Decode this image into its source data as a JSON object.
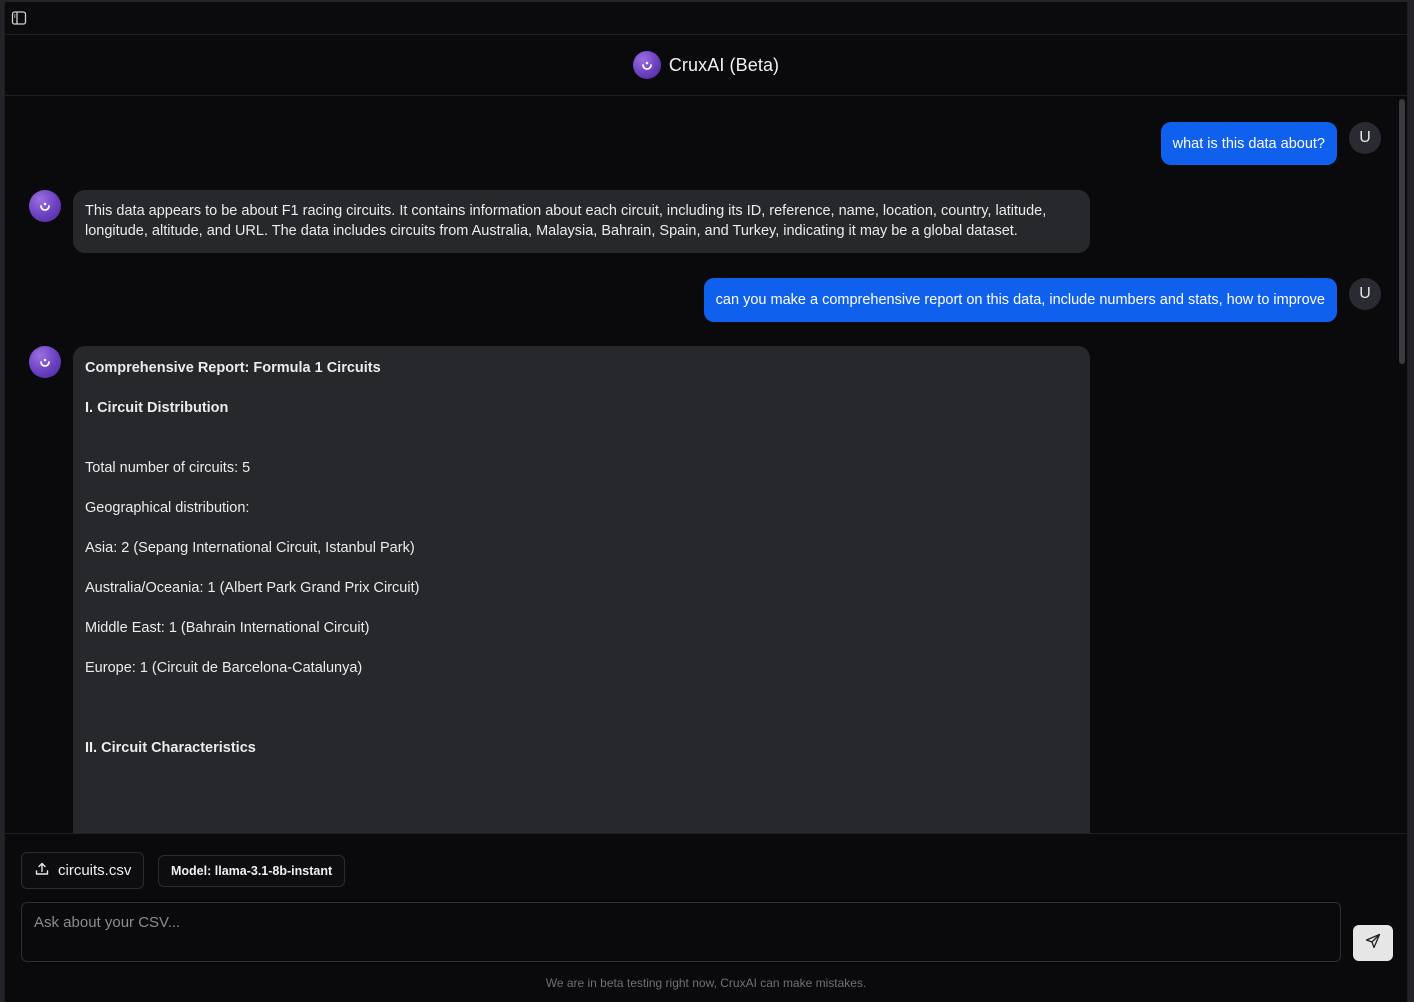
{
  "app": {
    "title": "CruxAI (Beta)"
  },
  "messages": [
    {
      "role": "user",
      "avatar": "U",
      "text": "what is this data about?"
    },
    {
      "role": "assistant",
      "text_line1": "This data appears to be about F1 racing circuits. It contains information about each circuit, including its ID, reference, name, location, country, latitude,",
      "text_line2": "longitude, altitude, and URL. The data includes circuits from Australia, Malaysia, Bahrain, Spain, and Turkey, indicating it may be a global dataset."
    },
    {
      "role": "user",
      "avatar": "U",
      "text": "can you make a comprehensive report on this data, include numbers and stats, how to improve"
    },
    {
      "role": "assistant",
      "report": {
        "title": "Comprehensive Report: Formula 1 Circuits",
        "section1": "I. Circuit Distribution",
        "total": "Total number of circuits: 5",
        "geo": "Geographical distribution:",
        "asia": "Asia: 2 (Sepang International Circuit, Istanbul Park)",
        "oceania": "Australia/Oceania: 1 (Albert Park Grand Prix Circuit)",
        "middle_east": "Middle East: 1 (Bahrain International Circuit)",
        "europe": "Europe: 1 (Circuit de Barcelona-Catalunya)",
        "section2": "II. Circuit Characteristics"
      }
    }
  ],
  "composer": {
    "file_name": "circuits.csv",
    "model_label": "Model: llama-3.1-8b-instant",
    "placeholder": "Ask about your CSV...",
    "disclaimer": "We are in beta testing right now, CruxAI can make mistakes."
  },
  "icons": {
    "sidebar_toggle": "sidebar-icon",
    "upload": "upload-icon",
    "send": "send-icon",
    "logo": "cruxai-logo"
  },
  "colors": {
    "accent_user_bubble": "#1060ee",
    "assistant_bubble": "#27282c",
    "background": "#0a0a0c",
    "logo_purple": "#6a3fc0"
  }
}
